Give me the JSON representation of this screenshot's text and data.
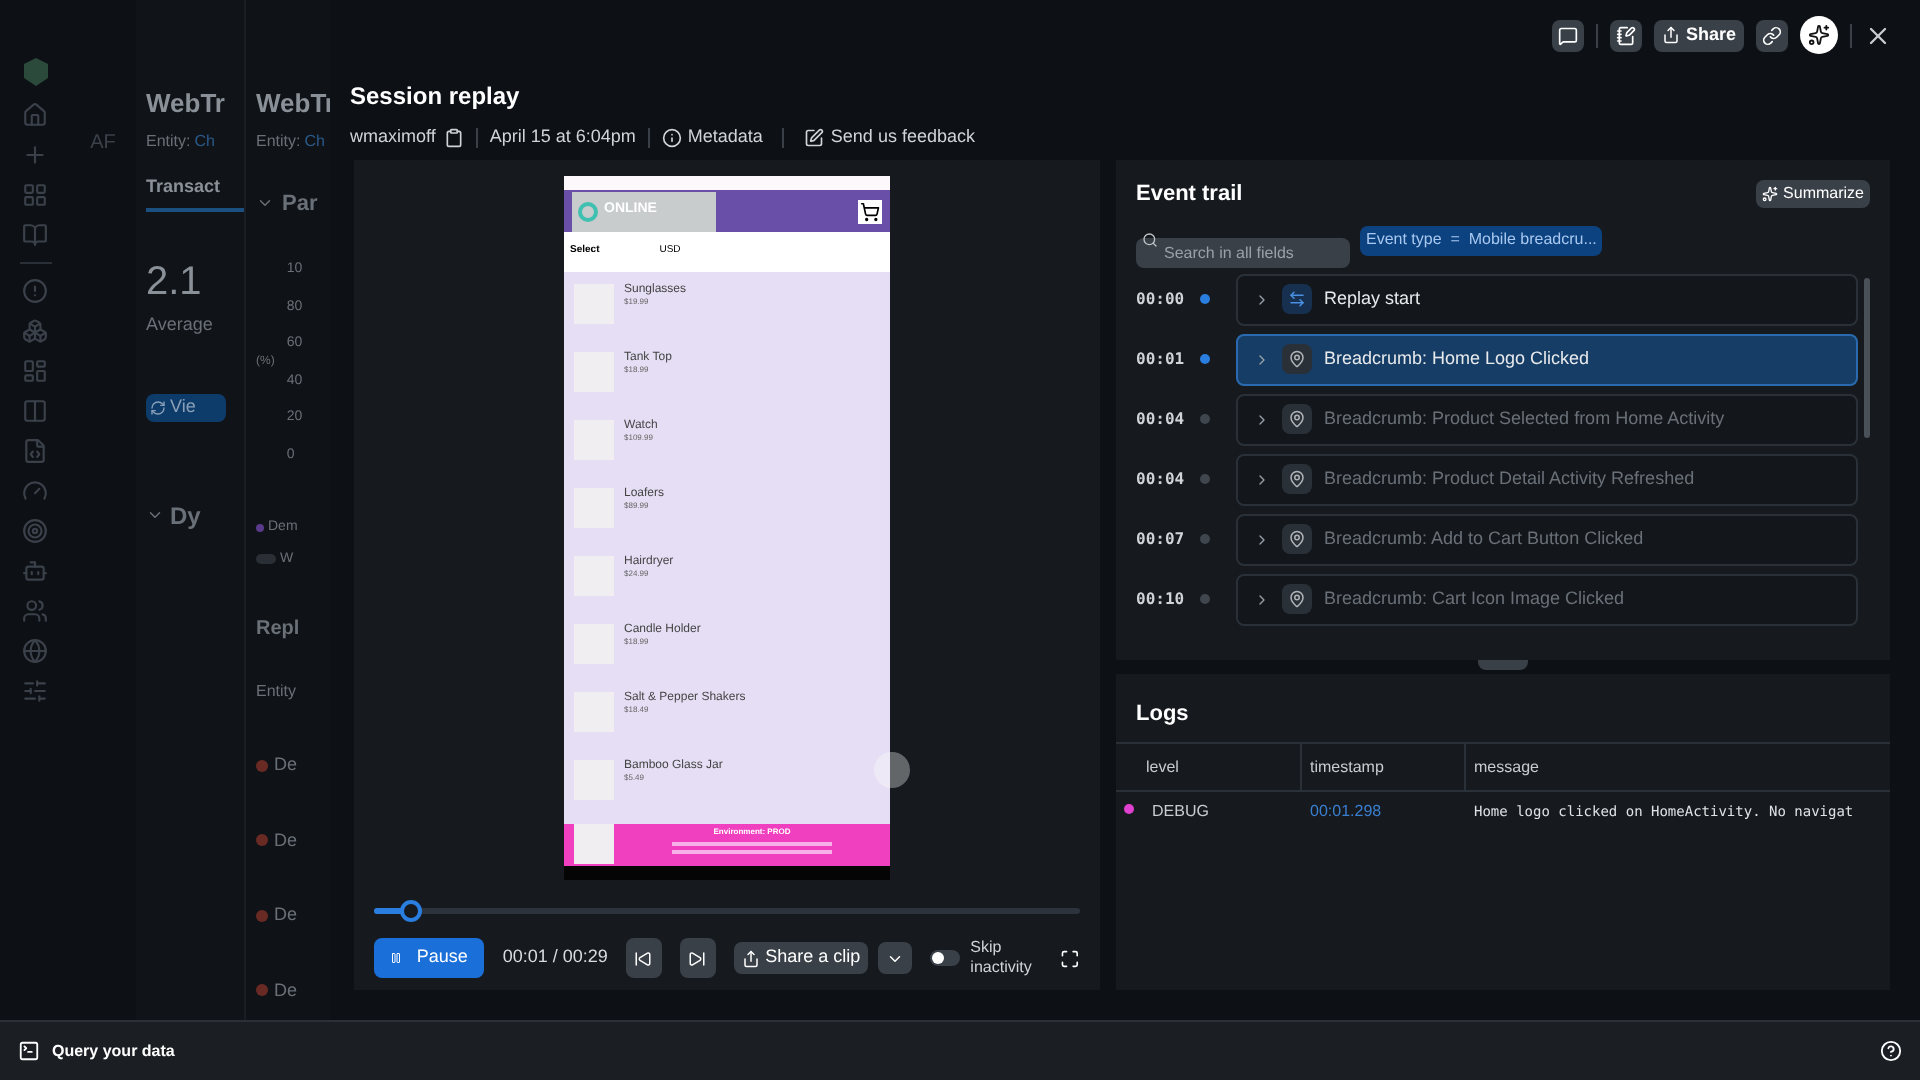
{
  "background_app": {
    "nav_label": "AF",
    "panel_1": {
      "title": "WebTr",
      "entity_label": "Entity:",
      "entity_value": "Ch",
      "tab": {
        "label": "Transact",
        "selected": true
      },
      "metric": "2.1",
      "metric_label": "Average",
      "button": "Vie",
      "section": "Dy"
    },
    "panel_2": {
      "title": "WebTr",
      "entity_label": "Entity:",
      "entity_value": "Ch",
      "section": "Par",
      "yticks": [
        "10",
        "80",
        "60",
        "40",
        "20",
        "0"
      ],
      "ylabel": "(%)",
      "legend": "Dem",
      "toggle": {
        "label": "W",
        "on": false
      },
      "replays_title": "Repl",
      "column": "Entity",
      "rows": [
        "De",
        "De",
        "De",
        "De"
      ]
    }
  },
  "toolbar": {
    "share": "Share"
  },
  "session": {
    "title": "Session replay",
    "user": "wmaximoff",
    "date": "April 15 at 6:04pm",
    "metadata": "Metadata",
    "feedback": "Send us feedback"
  },
  "phone": {
    "logo": "ONLINE",
    "select": "Select",
    "currency": "USD",
    "products": [
      {
        "name": "Sunglasses",
        "price": "$19.99"
      },
      {
        "name": "Tank Top",
        "price": "$18.99"
      },
      {
        "name": "Watch",
        "price": "$109.99"
      },
      {
        "name": "Loafers",
        "price": "$89.99"
      },
      {
        "name": "Hairdryer",
        "price": "$24.99"
      },
      {
        "name": "Candle Holder",
        "price": "$18.99"
      },
      {
        "name": "Salt & Pepper Shakers",
        "price": "$18.49"
      },
      {
        "name": "Bamboo Glass Jar",
        "price": "$5.49"
      }
    ],
    "footer": "Environment: PROD"
  },
  "player": {
    "seek": {
      "level": 0.05
    },
    "pause": "Pause",
    "time": "00:01 / 00:29",
    "share_clip": "Share a clip",
    "skip_inactivity": {
      "label": "Skip inactivity",
      "on": false
    }
  },
  "event_trail": {
    "title": "Event trail",
    "summarize": "Summarize",
    "search": {
      "placeholder": "Search in all fields"
    },
    "filter": "Event type  =  Mobile breadcru...",
    "events": [
      {
        "time": "00:00",
        "kind": "replay",
        "label": "Replay start",
        "played": true,
        "selected": false
      },
      {
        "time": "00:01",
        "kind": "breadcrumb",
        "label": "Breadcrumb: Home Logo Clicked",
        "played": true,
        "selected": true
      },
      {
        "time": "00:04",
        "kind": "breadcrumb",
        "label": "Breadcrumb: Product Selected from Home Activity",
        "played": false,
        "selected": false
      },
      {
        "time": "00:04",
        "kind": "breadcrumb",
        "label": "Breadcrumb: Product Detail Activity Refreshed",
        "played": false,
        "selected": false
      },
      {
        "time": "00:07",
        "kind": "breadcrumb",
        "label": "Breadcrumb: Add to Cart Button Clicked",
        "played": false,
        "selected": false
      },
      {
        "time": "00:10",
        "kind": "breadcrumb",
        "label": "Breadcrumb: Cart Icon Image Clicked",
        "played": false,
        "selected": false
      }
    ]
  },
  "logs": {
    "title": "Logs",
    "columns": [
      "level",
      "timestamp",
      "message"
    ],
    "rows": [
      {
        "color": "#e040d0",
        "level": "DEBUG",
        "timestamp": "00:01.298",
        "message": "Home logo clicked on HomeActivity. No navigat"
      }
    ]
  },
  "bottom_bar": {
    "query": "Query your data"
  }
}
